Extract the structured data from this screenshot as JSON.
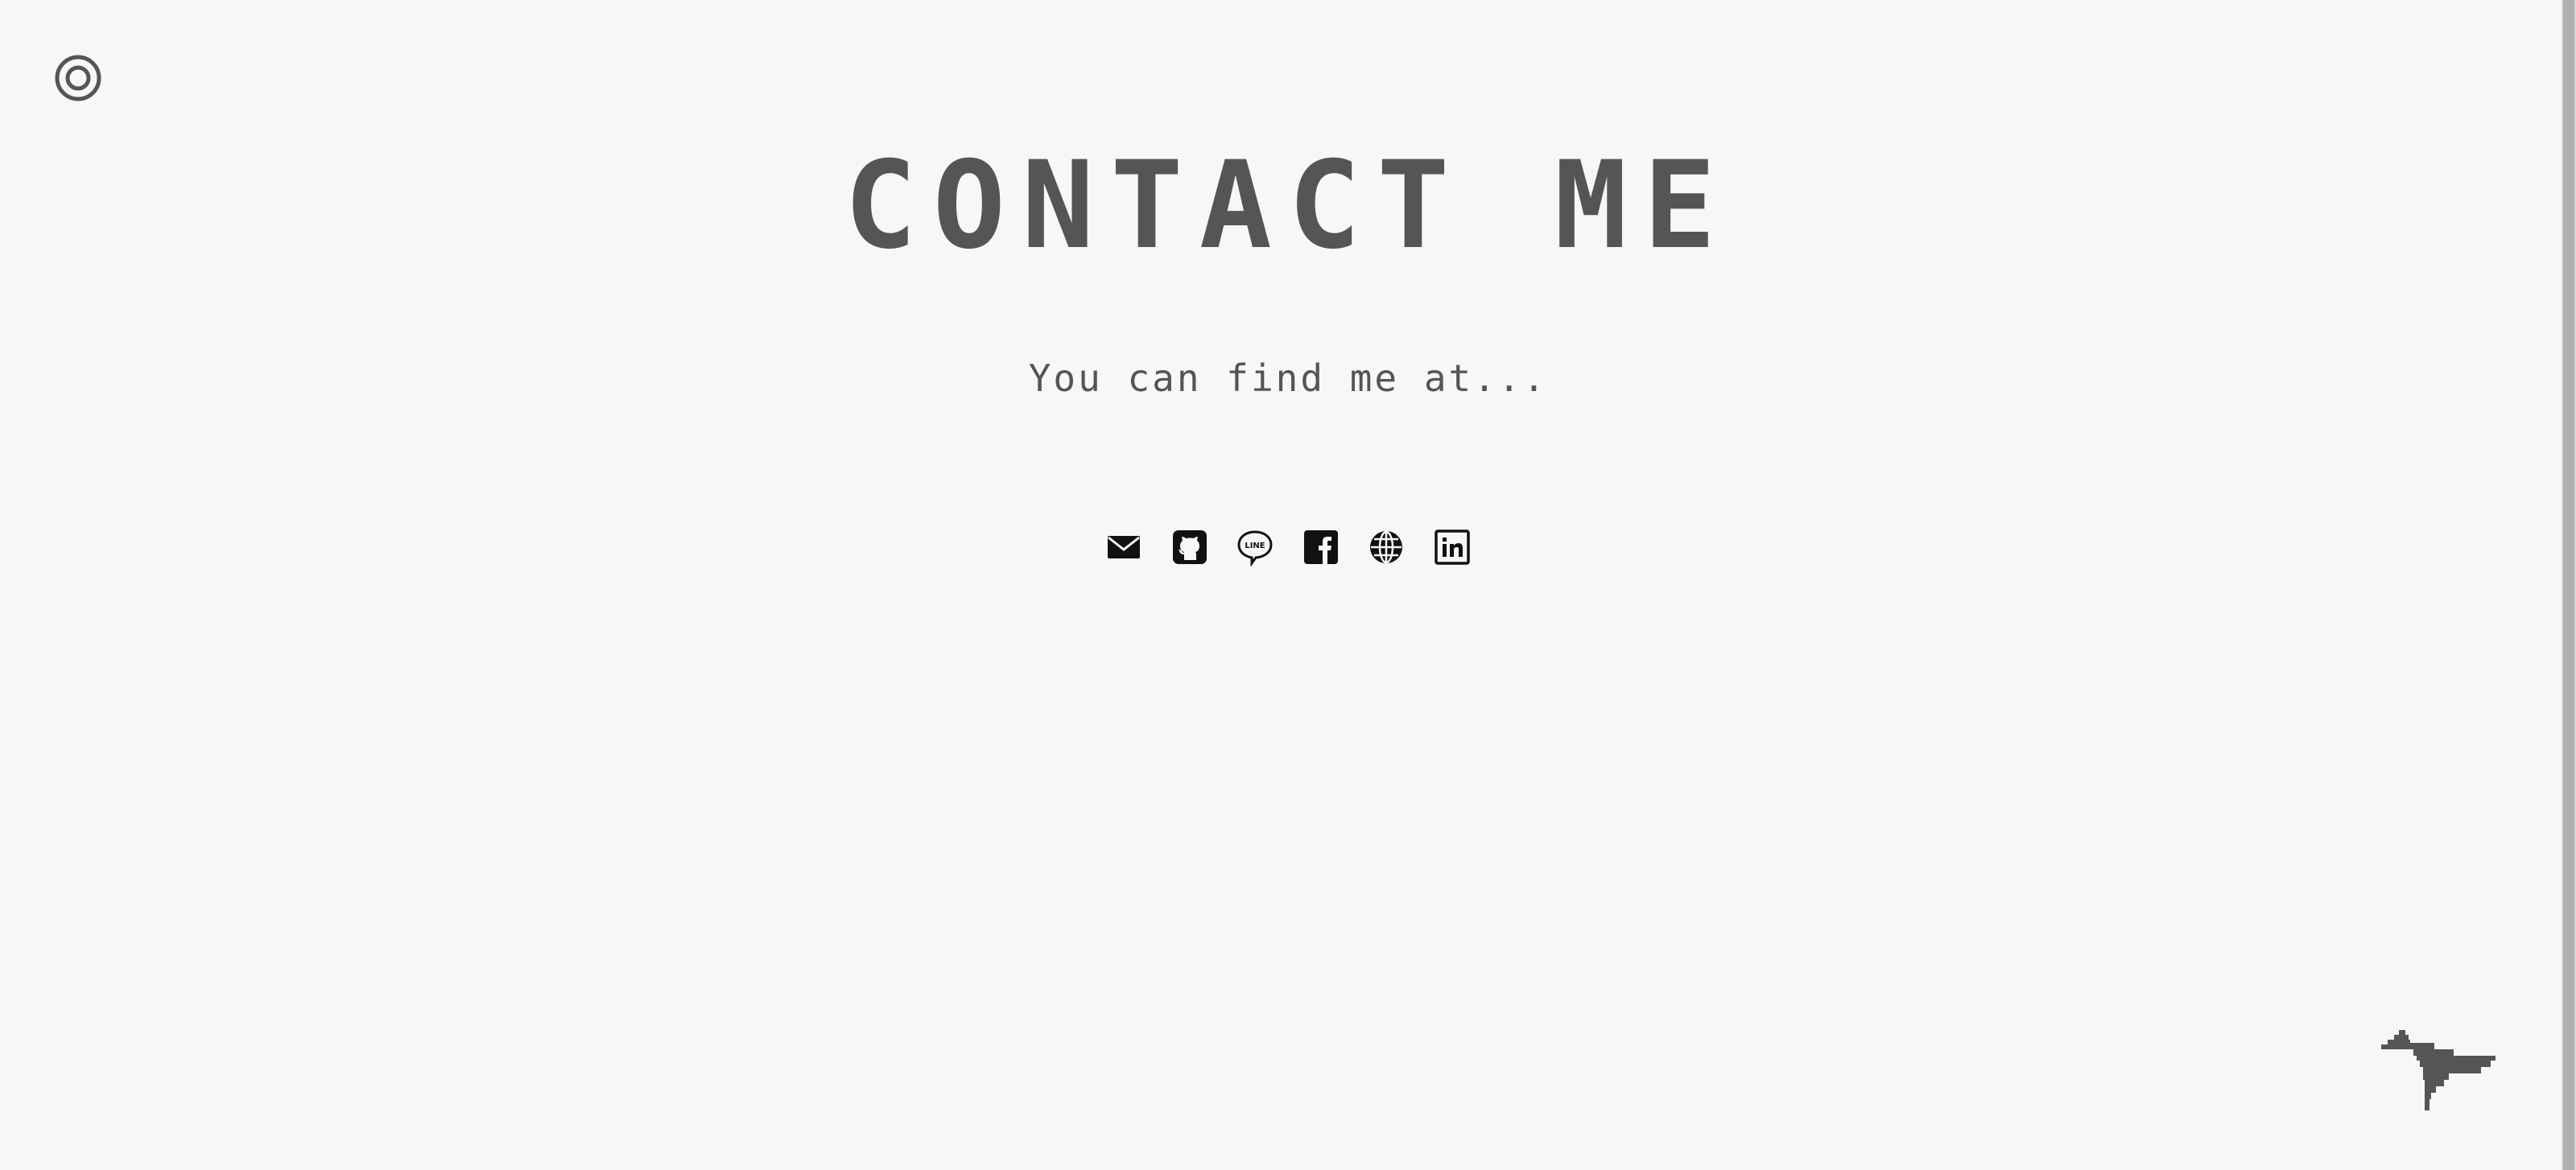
{
  "header": {
    "title": "CONTACT ME",
    "subtitle": "You can find me at..."
  },
  "menu": {
    "icon": "target-circle-icon"
  },
  "social_links": [
    {
      "name": "email",
      "icon": "mail-icon"
    },
    {
      "name": "github",
      "icon": "github-icon"
    },
    {
      "name": "line",
      "icon": "line-icon",
      "text": "LINE"
    },
    {
      "name": "facebook",
      "icon": "facebook-icon"
    },
    {
      "name": "website",
      "icon": "globe-icon"
    },
    {
      "name": "linkedin",
      "icon": "linkedin-icon"
    }
  ],
  "colors": {
    "background": "#f7f7f7",
    "text": "#555555",
    "icon": "#111111"
  }
}
